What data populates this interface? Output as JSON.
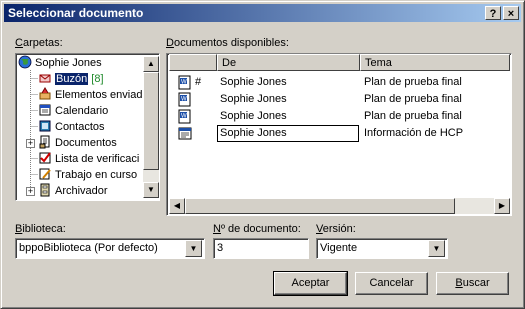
{
  "window": {
    "title": "Seleccionar documento",
    "help_glyph": "?",
    "close_glyph": "×"
  },
  "folders": {
    "label_mnemonic": "C",
    "label_rest": "arpetas:",
    "items": [
      {
        "label": "Sophie Jones",
        "icon": "globe-icon"
      },
      {
        "label": "Buzón",
        "count": "[8]",
        "icon": "inbox-icon"
      },
      {
        "label": "Elementos enviad",
        "icon": "sent-items-icon"
      },
      {
        "label": "Calendario",
        "icon": "calendar-icon"
      },
      {
        "label": "Contactos",
        "icon": "contacts-icon"
      },
      {
        "label": "Documentos",
        "icon": "documents-icon"
      },
      {
        "label": "Lista de verificaci",
        "icon": "checklist-icon"
      },
      {
        "label": "Trabajo en curso",
        "icon": "work-in-progress-icon"
      },
      {
        "label": "Archivador",
        "icon": "archive-icon"
      }
    ]
  },
  "documents": {
    "label_mnemonic": "D",
    "label_rest": "ocumentos disponibles:",
    "columns": [
      "De",
      "Tema"
    ],
    "rows": [
      {
        "from": "Sophie Jones",
        "subject": "Plan de prueba final",
        "icon": "word-doc-icon",
        "mark": "#"
      },
      {
        "from": "Sophie Jones",
        "subject": "Plan de prueba final",
        "icon": "word-doc-icon",
        "mark": ""
      },
      {
        "from": "Sophie Jones",
        "subject": "Plan de prueba final",
        "icon": "word-doc-icon",
        "mark": ""
      },
      {
        "from": "Sophie Jones",
        "subject": "Información de HCP",
        "icon": "form-doc-icon",
        "mark": ""
      }
    ]
  },
  "library": {
    "label_mnemonic": "B",
    "label_rest": "iblioteca:",
    "value": "bppoBiblioteca  (Por defecto)"
  },
  "doc_number": {
    "label_mnemonic": "N",
    "label_rest": "º de documento:",
    "value": "3"
  },
  "version": {
    "label_mnemonic": "V",
    "label_rest": "ersión:",
    "value": "Vigente"
  },
  "buttons": {
    "accept": "Aceptar",
    "cancel": "Cancelar",
    "search_mnemonic": "B",
    "search_rest": "uscar"
  }
}
